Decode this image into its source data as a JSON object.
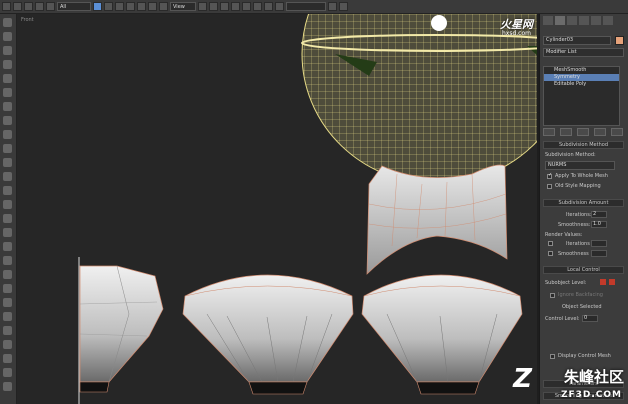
{
  "toolbar": {
    "filter_dropdown": "All",
    "view_dropdown": "View"
  },
  "viewport": {
    "label": "Front"
  },
  "panel": {
    "object_name": "Cylinder03",
    "modifier_list": "Modifier List",
    "stack": [
      "MeshSmooth",
      "Symmetry",
      "Editable Poly"
    ],
    "subdivision_method": {
      "header": "Subdivision Method",
      "label": "Subdivision Method:",
      "value": "NURMS",
      "apply_whole_mesh": "Apply To Whole Mesh",
      "old_style_mapping": "Old Style Mapping"
    },
    "subdivision_amount": {
      "header": "Subdivision Amount",
      "iterations_label": "Iterations:",
      "iterations_value": "2",
      "smoothness_label": "Smoothness:",
      "smoothness_value": "1.0",
      "render_values": "Render Values:",
      "render_iterations_label": "Iterations",
      "render_smoothness_label": "Smoothness"
    },
    "local_control": {
      "header": "Local Control",
      "subobject_level": "Subobject Level:",
      "ignore_backfacing": "Ignore Backfacing",
      "object_selected": "Object Selected",
      "control_level": "Control Level:",
      "control_level_value": "0",
      "display_control_mesh": "Display Control Mesh"
    },
    "parameters": "Parameters",
    "smoothing_parameters": "Smoothing Parameters"
  },
  "watermarks": {
    "top_brand": "火星网",
    "top_url": "hxsd.com",
    "bottom_brand": "朱峰社区",
    "bottom_url": "ZF3D.COM",
    "bottom_logo": "Z"
  }
}
